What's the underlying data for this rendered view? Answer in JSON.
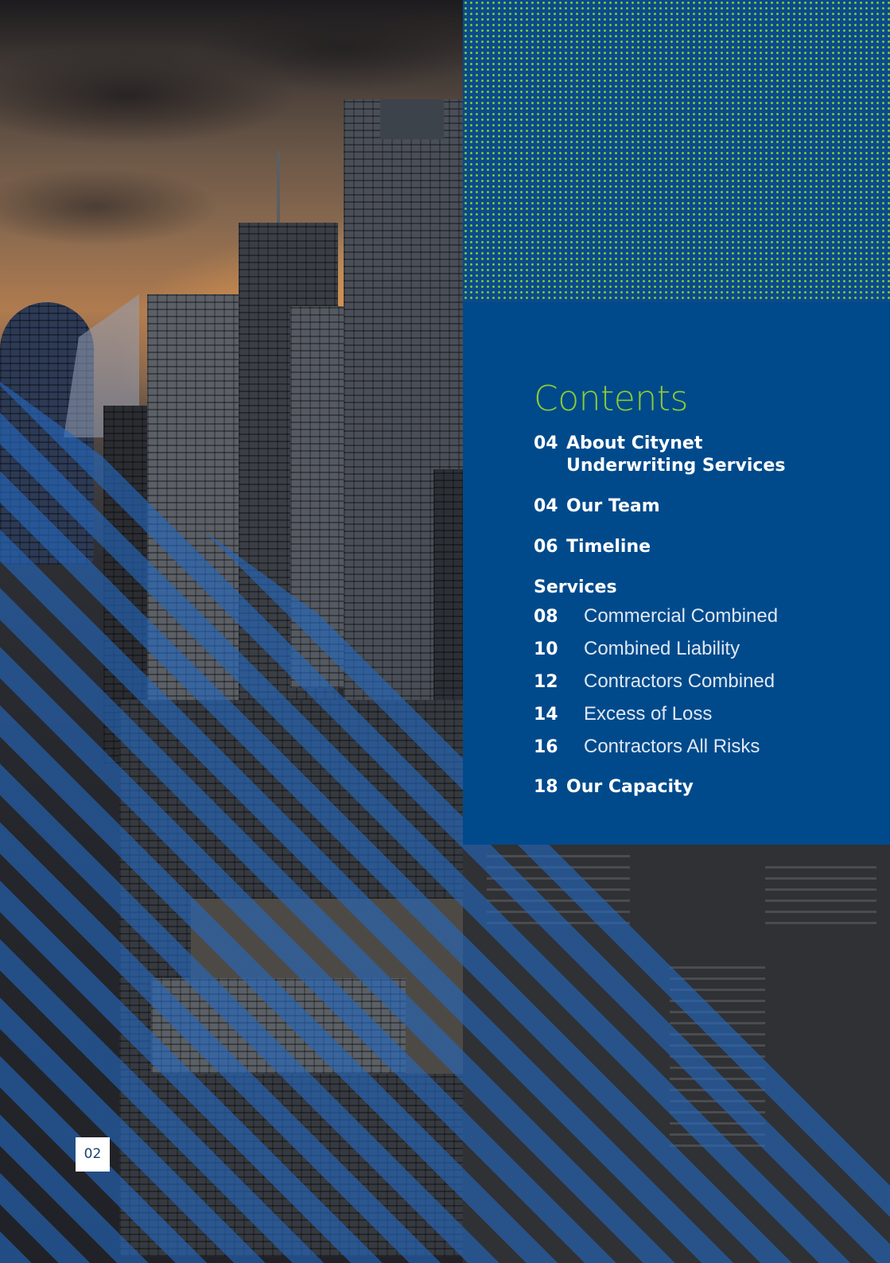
{
  "contents": {
    "title": "Contents",
    "entries_top": [
      {
        "number": "04",
        "label_line1": "About Citynet",
        "label_line2": "Underwriting Services"
      },
      {
        "number": "04",
        "label": "Our Team"
      },
      {
        "number": "06",
        "label": "Timeline"
      }
    ],
    "services": {
      "heading": "Services",
      "items": [
        {
          "number": "08",
          "label": "Commercial Combined"
        },
        {
          "number": "10",
          "label": "Combined Liability"
        },
        {
          "number": "12",
          "label": "Contractors Combined"
        },
        {
          "number": "14",
          "label": "Excess of Loss"
        },
        {
          "number": "16",
          "label": "Contractors All Risks"
        }
      ]
    },
    "entries_bottom": [
      {
        "number": "18",
        "label": "Our Capacity"
      }
    ]
  },
  "page_number": "02",
  "colors": {
    "panel_blue": "#004a8c",
    "title_green": "#8ccb32",
    "dot_green": "#7ecb2e",
    "stripe_blue": "#2468be"
  }
}
